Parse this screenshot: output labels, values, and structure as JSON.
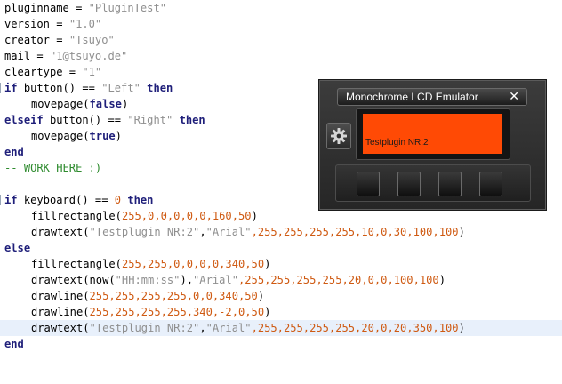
{
  "code": {
    "l1": {
      "ident": "pluginname",
      "eq": " = ",
      "str": "\"PluginTest\""
    },
    "l2": {
      "ident": "version",
      "eq": " = ",
      "str": "\"1.0\""
    },
    "l3": {
      "ident": "creator",
      "eq": " = ",
      "str": "\"Tsuyo\""
    },
    "l4": {
      "ident": "mail",
      "eq": " = ",
      "str": "\"1@tsuyo.de\""
    },
    "l5": {
      "ident": "cleartype",
      "eq": " = ",
      "str": "\"1\""
    },
    "l6": {
      "kw1": "if",
      "mid": " button() == ",
      "str": "\"Left\"",
      "kw2": " then"
    },
    "l7": {
      "fn": "movepage(",
      "kw": "false",
      "close": ")"
    },
    "l8": {
      "kw1": "elseif",
      "mid": " button() == ",
      "str": "\"Right\"",
      "kw2": " then"
    },
    "l9": {
      "fn": "movepage(",
      "kw": "true",
      "close": ")"
    },
    "l10": {
      "kw": "end"
    },
    "l11": {
      "comment": "-- WORK HERE :)"
    },
    "l13": {
      "kw1": "if",
      "mid": " keyboard() == ",
      "num": "0",
      "kw2": " then"
    },
    "l14": {
      "fn": "fillrectangle(",
      "args": "255,0,0,0,0,0,160,50",
      "close": ")"
    },
    "l15": {
      "fn": "drawtext(",
      "s1": "\"Testplugin NR:2\"",
      "comma": ",",
      "s2": "\"Arial\"",
      "args": ",255,255,255,255,10,0,30,100,100",
      "close": ")"
    },
    "l16": {
      "kw": "else"
    },
    "l17": {
      "fn": "fillrectangle(",
      "args": "255,255,0,0,0,0,340,50",
      "close": ")"
    },
    "l18": {
      "fn": "drawtext(now(",
      "s1": "\"HH:mm:ss\"",
      "mid": "),",
      "s2": "\"Arial\"",
      "args": ",255,255,255,255,20,0,0,100,100",
      "close": ")"
    },
    "l19": {
      "fn": "drawline(",
      "args": "255,255,255,255,0,0,340,50",
      "close": ")"
    },
    "l20": {
      "fn": "drawline(",
      "args": "255,255,255,255,340,-2,0,50",
      "close": ")"
    },
    "l21": {
      "fn": "drawtext(",
      "s1": "\"Testplugin NR:2\"",
      "comma": ",",
      "s2": "\"Arial\"",
      "args": ",255,255,255,255,20,0,20,350,100",
      "close": ")"
    },
    "l22": {
      "kw": "end"
    }
  },
  "lcd": {
    "title": "Monochrome LCD Emulator",
    "close_glyph": "✕",
    "screen_text": "Testplugin NR:2",
    "screen_color": "#ff4a05",
    "buttons": [
      "button-1",
      "button-2",
      "button-3",
      "button-4"
    ],
    "settings_icon": "gear-icon"
  },
  "colors": {
    "keyword": "#1f1f7a",
    "string": "#8f8f8f",
    "number": "#cf5a12",
    "comment": "#2e8b2e",
    "highlight": "#e8f0fb"
  }
}
